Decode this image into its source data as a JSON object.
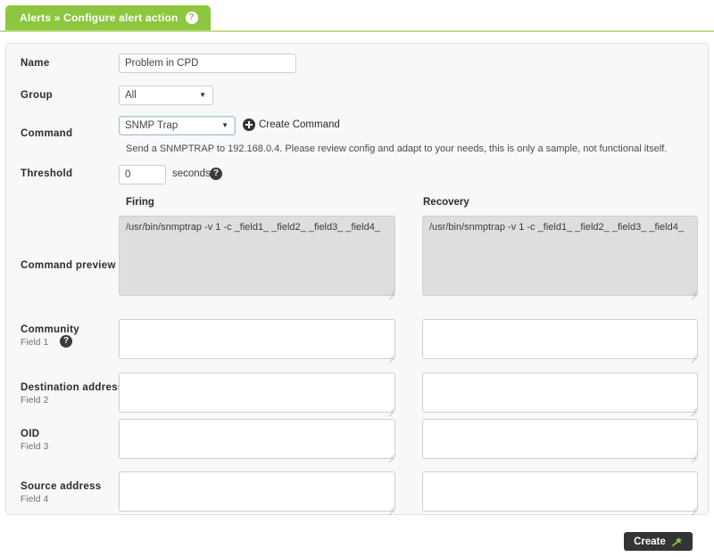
{
  "tab": {
    "title": "Alerts » Configure alert action",
    "help_icon": "help-circle-icon",
    "help_glyph": "?",
    "color": "#8dc63f"
  },
  "form": {
    "name": {
      "label": "Name",
      "value": "Problem in CPD",
      "placeholder": ""
    },
    "group": {
      "label": "Group",
      "value": "All",
      "caret": "▼"
    },
    "command": {
      "label": "Command",
      "value": "SNMP Trap",
      "caret": "▼",
      "create_command_label": "Create Command",
      "create_command_icon": "plus-circle-icon",
      "description": "Send a SNMPTRAP to 192.168.0.4. Please review config and adapt to your needs, this is only a sample, not functional itself."
    },
    "threshold": {
      "label": "Threshold",
      "value": "0",
      "unit": "seconds",
      "help_icon": "help-circle-icon",
      "help_glyph": "?"
    },
    "command_preview": {
      "label": "Command preview",
      "firing_header": "Firing",
      "recovery_header": "Recovery",
      "firing_value": "/usr/bin/snmptrap -v 1 -c _field1_ _field2_ _field3_ _field4_",
      "recovery_value": "/usr/bin/snmptrap -v 1 -c _field1_ _field2_ _field3_ _field4_"
    },
    "fields": [
      {
        "label": "Community",
        "sublabel": "Field 1",
        "help_icon": "help-circle-icon",
        "help_glyph": "?",
        "firing_value": "",
        "recovery_value": ""
      },
      {
        "label": "Destination address",
        "sublabel": "Field 2",
        "firing_value": "",
        "recovery_value": ""
      },
      {
        "label": "OID",
        "sublabel": "Field 3",
        "firing_value": "",
        "recovery_value": ""
      },
      {
        "label": "Source address",
        "sublabel": "Field 4",
        "firing_value": "",
        "recovery_value": ""
      }
    ]
  },
  "footer": {
    "create_label": "Create",
    "create_icon": "wand-icon",
    "create_icon_color": "#8dc63f"
  }
}
